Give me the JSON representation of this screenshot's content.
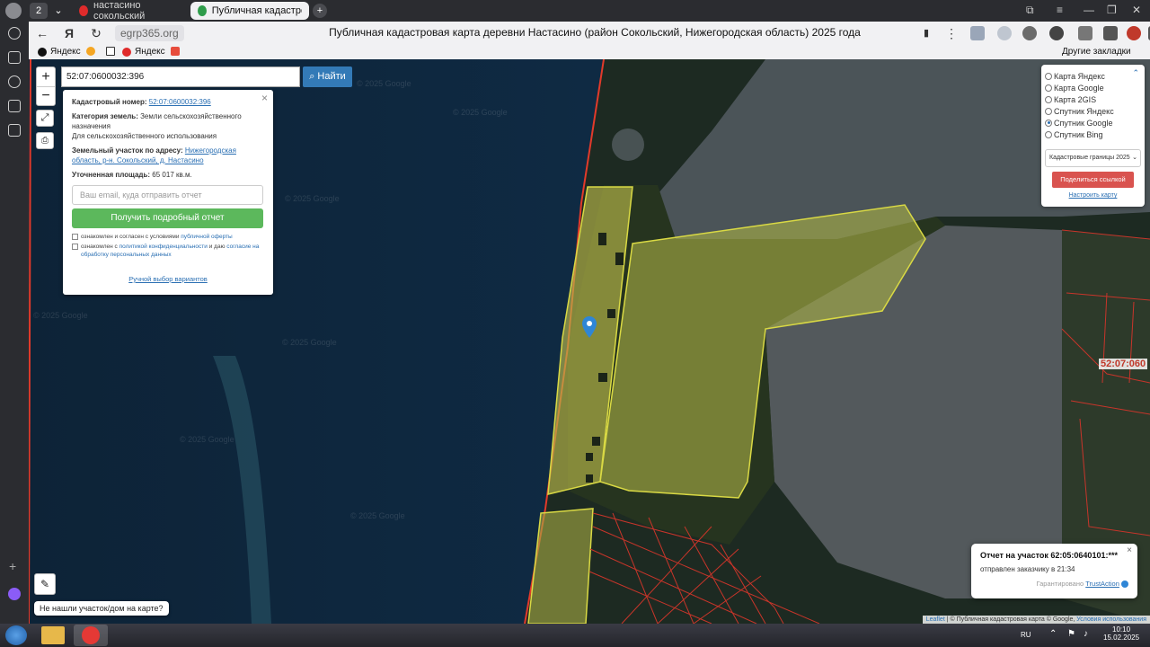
{
  "browser": {
    "tabs": [
      {
        "label": "настасино сокольский"
      },
      {
        "label": "Публичная кадастровая"
      }
    ],
    "tab_count": "2",
    "domain": "egrp365.org",
    "page_title": "Публичная кадастровая карта деревни Настасино (район Сокольский, Нижегородская область) 2025 года",
    "bookmarks": [
      "Яндекс",
      "Яндекс"
    ],
    "other_bookmarks": "Другие закладки"
  },
  "map": {
    "search_value": "52:07:0600032:396",
    "find_label": "Найти",
    "zoom_in": "+",
    "zoom_out": "−",
    "popup": {
      "cadnum_label": "Кадастровый номер:",
      "cadnum_value": "52:07:0600032:396",
      "category_label": "Категория земель:",
      "category_value": "Земли сельскохозяйственного назначения",
      "usage": "Для сельскохозяйственного использования",
      "address_label": "Земельный участок по адресу:",
      "address_value": "Нижегородская область, р-н. Сокольский, д. Настасино",
      "area_label": "Уточненная площадь:",
      "area_value": "65 017 кв.м.",
      "email_placeholder": "Ваш email, куда отправить отчет",
      "report_button": "Получить подробный отчет",
      "consent1_text": "ознакомлен и согласен с условиями",
      "consent1_link": "публичной оферты",
      "consent2_text": "ознакомлен с",
      "consent2_link1": "политикой конфиденциальности",
      "consent2_mid": "и даю",
      "consent2_link2": "согласие на обработку персональных данных",
      "manual_link": "Ручной выбор вариантов"
    },
    "layers": {
      "options": [
        "Карта Яндекс",
        "Карта Google",
        "Карта 2GIS",
        "Спутник Яндекс",
        "Спутник Google",
        "Спутник Bing"
      ],
      "selected": "Спутник Google",
      "select_value": "Кадастровые границы 2025",
      "share_button": "Поделиться ссылкой",
      "setup_link": "Настроить карту"
    },
    "cad_label": "52:07:060",
    "watermark": "© 2025 Google",
    "toast": {
      "title": "Отчет на участок 62:05:0640101:***",
      "body": "отправлен заказчику в 21:34",
      "guarantee": "Гарантировано",
      "guarantee_link": "TrustAction"
    },
    "not_found": "Не нашли участок/дом на карте?",
    "attribution": {
      "leaflet": "Leaflet",
      "text1": "© Публичная кадастровая карта",
      "text2": "© Google,",
      "link": "Условия использования"
    }
  },
  "taskbar": {
    "lang": "RU",
    "time": "10:10",
    "date": "15.02.2025"
  }
}
